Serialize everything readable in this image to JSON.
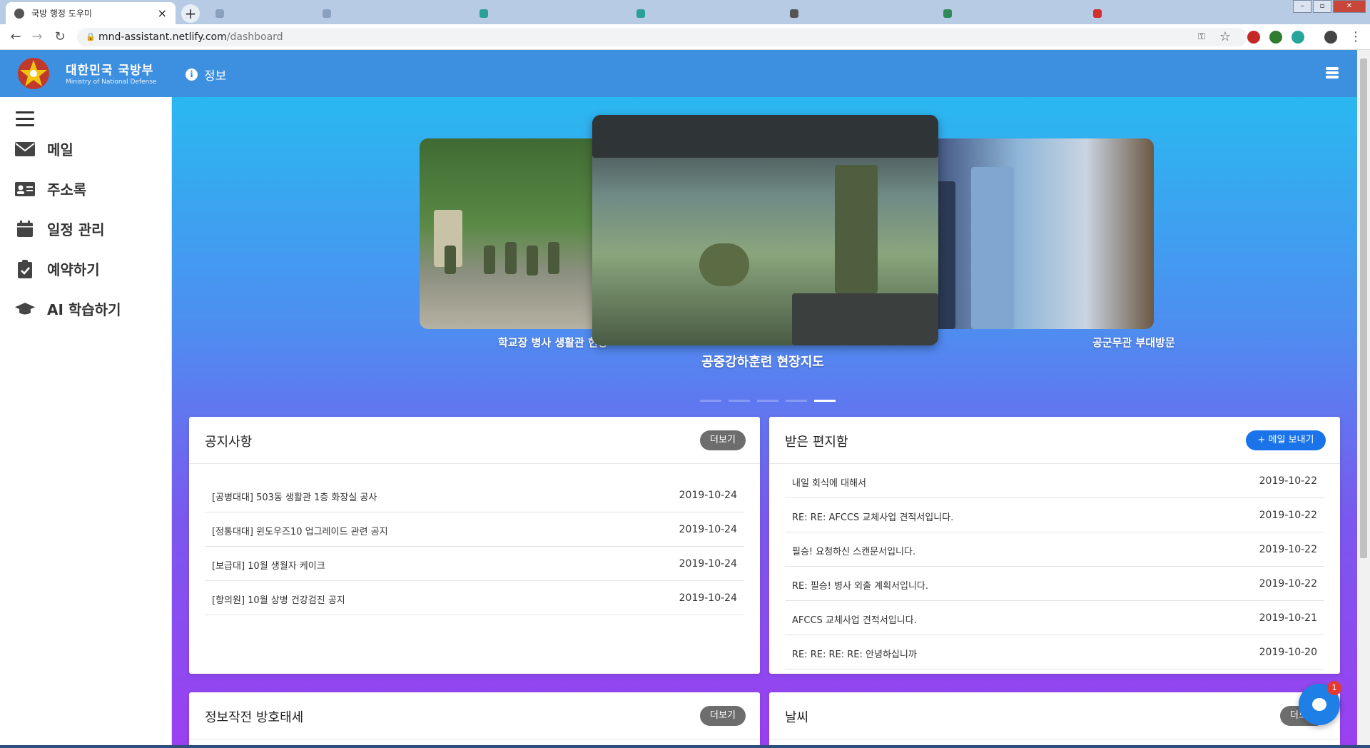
{
  "browser": {
    "active_tab_title": "국방 행정 도우미",
    "background_tabs": [
      "",
      "",
      "",
      "",
      "",
      "",
      ""
    ],
    "url_host": "mnd-assistant.netlify.com",
    "url_path": "/dashboard"
  },
  "header": {
    "logo_ko": "대한민국 국방부",
    "logo_en": "Ministry of National Defense",
    "info_label": "정보"
  },
  "sidebar": {
    "items": [
      {
        "label": "메일",
        "icon": "envelope-icon"
      },
      {
        "label": "주소록",
        "icon": "address-card-icon"
      },
      {
        "label": "일정 관리",
        "icon": "calendar-icon"
      },
      {
        "label": "예약하기",
        "icon": "clipboard-check-icon"
      },
      {
        "label": "AI 학습하기",
        "icon": "graduation-cap-icon"
      }
    ]
  },
  "carousel": {
    "captions": {
      "left": "학교장 병사 생활관 현장",
      "center": "공중강하훈련 현장지도",
      "right": "공군무관 부대방문"
    },
    "active_index": 5,
    "total": 5
  },
  "notices": {
    "title": "공지사항",
    "more_label": "더보기",
    "items": [
      {
        "title": "[공병대대] 503동 생활관 1층 화장실 공사",
        "date": "2019-10-24"
      },
      {
        "title": "[정통대대] 윈도우즈10 업그레이드 관련 공지",
        "date": "2019-10-24"
      },
      {
        "title": "[보급대] 10월 생월자 케이크",
        "date": "2019-10-24"
      },
      {
        "title": "[항의원] 10월 상병 건강검진 공지",
        "date": "2019-10-24"
      }
    ]
  },
  "inbox": {
    "title": "받은 편지함",
    "send_label": "메일 보내기",
    "items": [
      {
        "title": "내일 회식에 대해서",
        "date": "2019-10-22"
      },
      {
        "title": "RE: RE: AFCCS 교체사업 견적서입니다.",
        "date": "2019-10-22"
      },
      {
        "title": "필승! 요청하신 스캔문서입니다.",
        "date": "2019-10-22"
      },
      {
        "title": "RE: 필승! 병사 외출 계획서입니다.",
        "date": "2019-10-22"
      },
      {
        "title": "AFCCS 교체사업 견적서입니다.",
        "date": "2019-10-21"
      },
      {
        "title": "RE: RE: RE: RE: 안녕하십니까",
        "date": "2019-10-20"
      }
    ]
  },
  "infosec": {
    "title": "정보작전 방호태세",
    "more_label": "더보기"
  },
  "weather": {
    "title": "날씨",
    "more_label": "더보기"
  },
  "chat": {
    "badge_count": "1"
  },
  "colors": {
    "header": "#3d8fe0",
    "primary_button": "#1a73e8",
    "gradient_top": "#2ab8f0",
    "gradient_bottom": "#9b40f0"
  }
}
